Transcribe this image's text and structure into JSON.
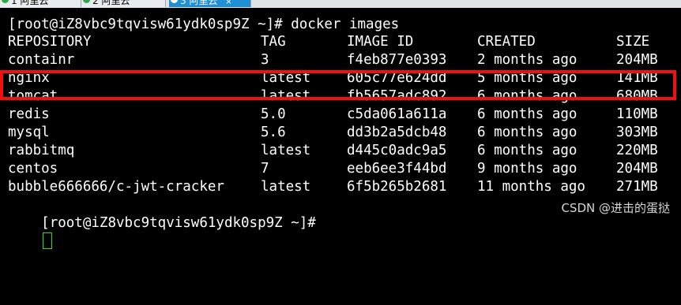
{
  "tabs": [
    {
      "label": "1 阿里云",
      "active": false
    },
    {
      "label": "2 阿里云",
      "active": false
    },
    {
      "label": "3 阿里云",
      "active": true
    }
  ],
  "terminal": {
    "prompt_command": "[root@iZ8vbc9tqvisw61ydk0sp9Z ~]# docker images",
    "headers": {
      "repo": "REPOSITORY",
      "tag": "TAG",
      "id": "IMAGE ID",
      "created": "CREATED",
      "size": "SIZE"
    },
    "rows": [
      {
        "repo": "containr",
        "tag": "3",
        "id": "f4eb877e0393",
        "created": "2 months ago",
        "size": "204MB"
      },
      {
        "repo": "nginx",
        "tag": "latest",
        "id": "605c77e624dd",
        "created": "5 months ago",
        "size": "141MB"
      },
      {
        "repo": "tomcat",
        "tag": "latest",
        "id": "fb5657adc892",
        "created": "6 months ago",
        "size": "680MB"
      },
      {
        "repo": "redis",
        "tag": "5.0",
        "id": "c5da061a611a",
        "created": "6 months ago",
        "size": "110MB"
      },
      {
        "repo": "mysql",
        "tag": "5.6",
        "id": "dd3b2a5dcb48",
        "created": "6 months ago",
        "size": "303MB"
      },
      {
        "repo": "rabbitmq",
        "tag": "latest",
        "id": "d445c0adc9a5",
        "created": "6 months ago",
        "size": "220MB"
      },
      {
        "repo": "centos",
        "tag": "7",
        "id": "eeb6ee3f44bd",
        "created": "9 months ago",
        "size": "204MB"
      },
      {
        "repo": "bubble666666/c-jwt-cracker",
        "tag": "latest",
        "id": "6f5b265b2681",
        "created": "11 months ago",
        "size": "271MB"
      }
    ],
    "final_prompt": "[root@iZ8vbc9tqvisw61ydk0sp9Z ~]#",
    "highlight_color": "#ef1010",
    "cursor_color": "#21e021"
  },
  "watermark": "CSDN @进击的蛋挞"
}
